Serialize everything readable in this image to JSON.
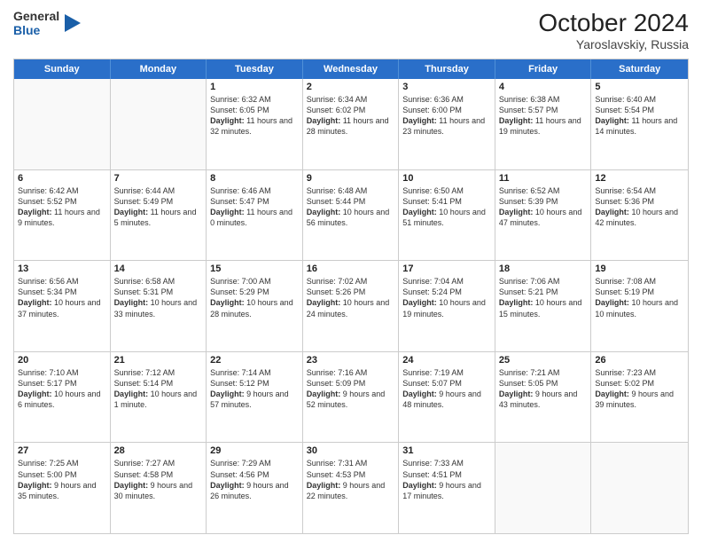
{
  "logo": {
    "general": "General",
    "blue": "Blue"
  },
  "title": {
    "month_year": "October 2024",
    "location": "Yaroslavskiy, Russia"
  },
  "day_names": [
    "Sunday",
    "Monday",
    "Tuesday",
    "Wednesday",
    "Thursday",
    "Friday",
    "Saturday"
  ],
  "weeks": [
    [
      {
        "day": "",
        "sunrise": "",
        "sunset": "",
        "daylight": ""
      },
      {
        "day": "",
        "sunrise": "",
        "sunset": "",
        "daylight": ""
      },
      {
        "day": "1",
        "sunrise": "Sunrise: 6:32 AM",
        "sunset": "Sunset: 6:05 PM",
        "daylight": "Daylight: 11 hours and 32 minutes."
      },
      {
        "day": "2",
        "sunrise": "Sunrise: 6:34 AM",
        "sunset": "Sunset: 6:02 PM",
        "daylight": "Daylight: 11 hours and 28 minutes."
      },
      {
        "day": "3",
        "sunrise": "Sunrise: 6:36 AM",
        "sunset": "Sunset: 6:00 PM",
        "daylight": "Daylight: 11 hours and 23 minutes."
      },
      {
        "day": "4",
        "sunrise": "Sunrise: 6:38 AM",
        "sunset": "Sunset: 5:57 PM",
        "daylight": "Daylight: 11 hours and 19 minutes."
      },
      {
        "day": "5",
        "sunrise": "Sunrise: 6:40 AM",
        "sunset": "Sunset: 5:54 PM",
        "daylight": "Daylight: 11 hours and 14 minutes."
      }
    ],
    [
      {
        "day": "6",
        "sunrise": "Sunrise: 6:42 AM",
        "sunset": "Sunset: 5:52 PM",
        "daylight": "Daylight: 11 hours and 9 minutes."
      },
      {
        "day": "7",
        "sunrise": "Sunrise: 6:44 AM",
        "sunset": "Sunset: 5:49 PM",
        "daylight": "Daylight: 11 hours and 5 minutes."
      },
      {
        "day": "8",
        "sunrise": "Sunrise: 6:46 AM",
        "sunset": "Sunset: 5:47 PM",
        "daylight": "Daylight: 11 hours and 0 minutes."
      },
      {
        "day": "9",
        "sunrise": "Sunrise: 6:48 AM",
        "sunset": "Sunset: 5:44 PM",
        "daylight": "Daylight: 10 hours and 56 minutes."
      },
      {
        "day": "10",
        "sunrise": "Sunrise: 6:50 AM",
        "sunset": "Sunset: 5:41 PM",
        "daylight": "Daylight: 10 hours and 51 minutes."
      },
      {
        "day": "11",
        "sunrise": "Sunrise: 6:52 AM",
        "sunset": "Sunset: 5:39 PM",
        "daylight": "Daylight: 10 hours and 47 minutes."
      },
      {
        "day": "12",
        "sunrise": "Sunrise: 6:54 AM",
        "sunset": "Sunset: 5:36 PM",
        "daylight": "Daylight: 10 hours and 42 minutes."
      }
    ],
    [
      {
        "day": "13",
        "sunrise": "Sunrise: 6:56 AM",
        "sunset": "Sunset: 5:34 PM",
        "daylight": "Daylight: 10 hours and 37 minutes."
      },
      {
        "day": "14",
        "sunrise": "Sunrise: 6:58 AM",
        "sunset": "Sunset: 5:31 PM",
        "daylight": "Daylight: 10 hours and 33 minutes."
      },
      {
        "day": "15",
        "sunrise": "Sunrise: 7:00 AM",
        "sunset": "Sunset: 5:29 PM",
        "daylight": "Daylight: 10 hours and 28 minutes."
      },
      {
        "day": "16",
        "sunrise": "Sunrise: 7:02 AM",
        "sunset": "Sunset: 5:26 PM",
        "daylight": "Daylight: 10 hours and 24 minutes."
      },
      {
        "day": "17",
        "sunrise": "Sunrise: 7:04 AM",
        "sunset": "Sunset: 5:24 PM",
        "daylight": "Daylight: 10 hours and 19 minutes."
      },
      {
        "day": "18",
        "sunrise": "Sunrise: 7:06 AM",
        "sunset": "Sunset: 5:21 PM",
        "daylight": "Daylight: 10 hours and 15 minutes."
      },
      {
        "day": "19",
        "sunrise": "Sunrise: 7:08 AM",
        "sunset": "Sunset: 5:19 PM",
        "daylight": "Daylight: 10 hours and 10 minutes."
      }
    ],
    [
      {
        "day": "20",
        "sunrise": "Sunrise: 7:10 AM",
        "sunset": "Sunset: 5:17 PM",
        "daylight": "Daylight: 10 hours and 6 minutes."
      },
      {
        "day": "21",
        "sunrise": "Sunrise: 7:12 AM",
        "sunset": "Sunset: 5:14 PM",
        "daylight": "Daylight: 10 hours and 1 minute."
      },
      {
        "day": "22",
        "sunrise": "Sunrise: 7:14 AM",
        "sunset": "Sunset: 5:12 PM",
        "daylight": "Daylight: 9 hours and 57 minutes."
      },
      {
        "day": "23",
        "sunrise": "Sunrise: 7:16 AM",
        "sunset": "Sunset: 5:09 PM",
        "daylight": "Daylight: 9 hours and 52 minutes."
      },
      {
        "day": "24",
        "sunrise": "Sunrise: 7:19 AM",
        "sunset": "Sunset: 5:07 PM",
        "daylight": "Daylight: 9 hours and 48 minutes."
      },
      {
        "day": "25",
        "sunrise": "Sunrise: 7:21 AM",
        "sunset": "Sunset: 5:05 PM",
        "daylight": "Daylight: 9 hours and 43 minutes."
      },
      {
        "day": "26",
        "sunrise": "Sunrise: 7:23 AM",
        "sunset": "Sunset: 5:02 PM",
        "daylight": "Daylight: 9 hours and 39 minutes."
      }
    ],
    [
      {
        "day": "27",
        "sunrise": "Sunrise: 7:25 AM",
        "sunset": "Sunset: 5:00 PM",
        "daylight": "Daylight: 9 hours and 35 minutes."
      },
      {
        "day": "28",
        "sunrise": "Sunrise: 7:27 AM",
        "sunset": "Sunset: 4:58 PM",
        "daylight": "Daylight: 9 hours and 30 minutes."
      },
      {
        "day": "29",
        "sunrise": "Sunrise: 7:29 AM",
        "sunset": "Sunset: 4:56 PM",
        "daylight": "Daylight: 9 hours and 26 minutes."
      },
      {
        "day": "30",
        "sunrise": "Sunrise: 7:31 AM",
        "sunset": "Sunset: 4:53 PM",
        "daylight": "Daylight: 9 hours and 22 minutes."
      },
      {
        "day": "31",
        "sunrise": "Sunrise: 7:33 AM",
        "sunset": "Sunset: 4:51 PM",
        "daylight": "Daylight: 9 hours and 17 minutes."
      },
      {
        "day": "",
        "sunrise": "",
        "sunset": "",
        "daylight": ""
      },
      {
        "day": "",
        "sunrise": "",
        "sunset": "",
        "daylight": ""
      }
    ]
  ]
}
